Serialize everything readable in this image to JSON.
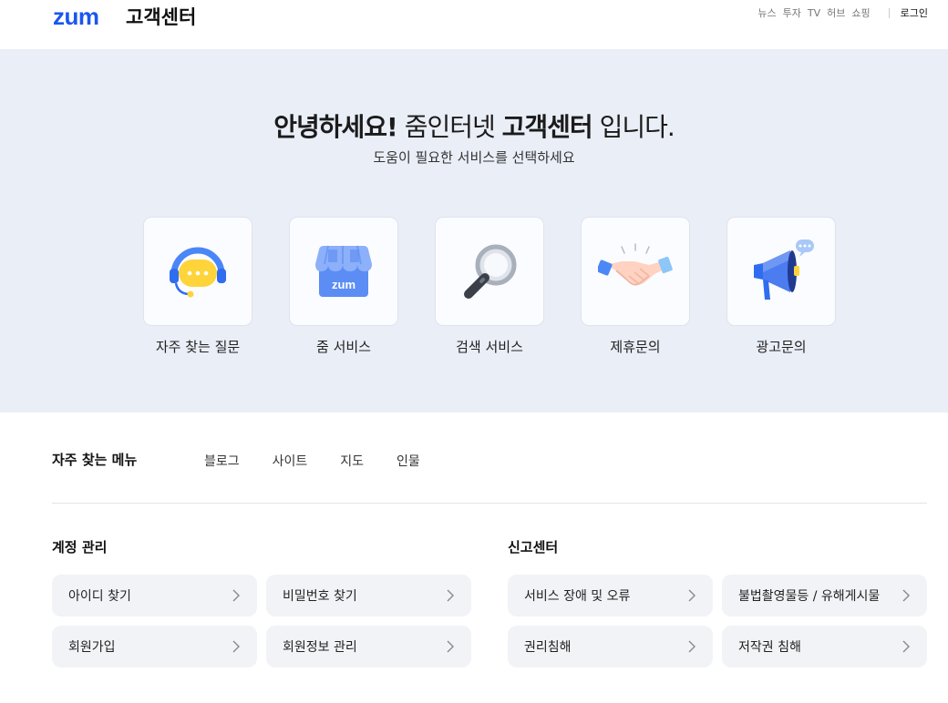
{
  "header": {
    "logo": "zum",
    "title": "고객센터",
    "nav": [
      "뉴스",
      "투자",
      "TV",
      "허브",
      "쇼핑"
    ],
    "login": "로그인"
  },
  "hero": {
    "greeting_bold": "안녕하세요!",
    "greeting_mid": " 줌인터넷 ",
    "greeting_bold2": "고객센터",
    "greeting_end": " 입니다.",
    "subtitle": "도움이 필요한 서비스를 선택하세요",
    "cards": [
      {
        "label": "자주 찾는 질문",
        "icon": "headset-icon"
      },
      {
        "label": "줌 서비스",
        "icon": "zum-store-icon",
        "icon_text": "zum"
      },
      {
        "label": "검색 서비스",
        "icon": "magnifier-icon"
      },
      {
        "label": "제휴문의",
        "icon": "handshake-icon"
      },
      {
        "label": "광고문의",
        "icon": "megaphone-icon"
      }
    ]
  },
  "frequent_menu": {
    "title": "자주 찾는 메뉴",
    "links": [
      "블로그",
      "사이트",
      "지도",
      "인물"
    ]
  },
  "account": {
    "title": "계정 관리",
    "items": [
      "아이디 찾기",
      "비밀번호 찾기",
      "회원가입",
      "회원정보 관리"
    ]
  },
  "report": {
    "title": "신고센터",
    "items": [
      "서비스 장애 및 오류",
      "불법촬영물등 / 유해게시물",
      "권리침해",
      "저작권 침해"
    ]
  },
  "colors": {
    "brand": "#1a56f0",
    "hero_bg": "#eaeef7",
    "item_bg": "#f2f3f6"
  }
}
